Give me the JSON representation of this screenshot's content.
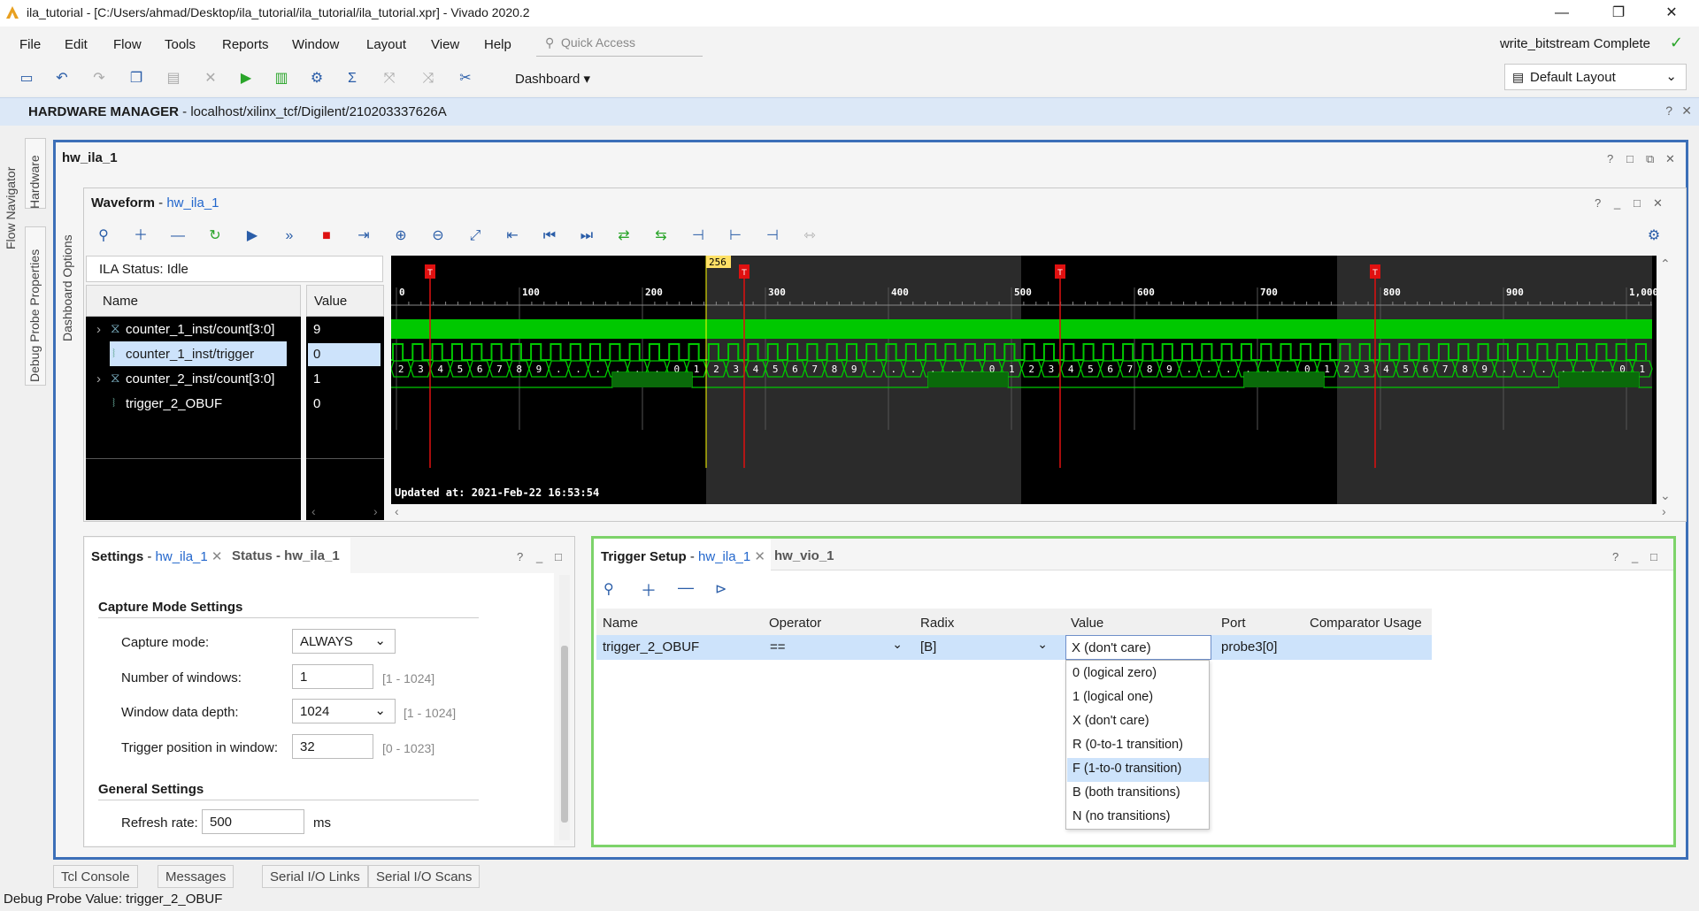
{
  "window": {
    "title": "ila_tutorial - [C:/Users/ahmad/Desktop/ila_tutorial/ila_tutorial/ila_tutorial.xpr] - Vivado 2020.2"
  },
  "menu": [
    "File",
    "Edit",
    "Flow",
    "Tools",
    "Reports",
    "Window",
    "Layout",
    "View",
    "Help"
  ],
  "quick_access": "Quick Access",
  "build_status": "write_bitstream Complete",
  "toolbar": {
    "dashboard": "Dashboard",
    "layout": "Default Layout"
  },
  "hw_manager": {
    "title": "HARDWARE MANAGER",
    "path": "- localhost/xilinx_tcf/Digilent/210203337626A"
  },
  "left_tabs": [
    "Flow Navigator",
    "Hardware",
    "Debug Probe Properties",
    "Dashboard Options"
  ],
  "main_panel": {
    "title": "hw_ila_1"
  },
  "waveform": {
    "title": "Waveform",
    "link": "hw_ila_1",
    "ila_status": "ILA Status:  Idle",
    "col_name": "Name",
    "col_value": "Value",
    "signals": [
      {
        "name": "counter_1_inst/count[3:0]",
        "value": "9",
        "type": "bus"
      },
      {
        "name": "counter_1_inst/trigger",
        "value": "0",
        "type": "bit"
      },
      {
        "name": "counter_2_inst/count[3:0]",
        "value": "1",
        "type": "bus"
      },
      {
        "name": "trigger_2_OBUF",
        "value": "0",
        "type": "bit"
      }
    ],
    "marker": "256",
    "ticks": [
      "0",
      "100",
      "200",
      "300",
      "400",
      "500",
      "600",
      "700",
      "800",
      "900",
      "1,000"
    ],
    "updated": "Updated at: 2021-Feb-22 16:53:54",
    "trigger_flags": [
      "T",
      "T",
      "T",
      "T"
    ],
    "bus2_values": [
      "2",
      "3",
      "4",
      "5",
      "6",
      "7",
      "8",
      "9",
      ".",
      ".",
      ".",
      ".",
      ".",
      ".",
      "0",
      "1",
      "2",
      "3",
      "4",
      "5",
      "6",
      "7",
      "8",
      "9",
      ".",
      ".",
      ".",
      ".",
      ".",
      ".",
      "0",
      "1",
      "2",
      "3",
      "4",
      "5",
      "6",
      "7",
      "8",
      "9",
      ".",
      ".",
      ".",
      ".",
      ".",
      ".",
      "0",
      "1",
      "2",
      "3",
      "4",
      "5",
      "6",
      "7",
      "8",
      "9",
      ".",
      ".",
      ".",
      ".",
      ".",
      ".",
      "0",
      "1"
    ]
  },
  "settings": {
    "tab_active": "Settings",
    "tab_active_link": "hw_ila_1",
    "tab_other": "Status - hw_ila_1",
    "capture_section": "Capture Mode Settings",
    "capture_mode_label": "Capture mode:",
    "capture_mode_value": "ALWAYS",
    "windows_label": "Number of windows:",
    "windows_value": "1",
    "windows_hint": "[1 - 1024]",
    "depth_label": "Window data depth:",
    "depth_value": "1024",
    "depth_hint": "[1 - 1024]",
    "trigpos_label": "Trigger position in window:",
    "trigpos_value": "32",
    "trigpos_hint": "[0 - 1023]",
    "general_section": "General Settings",
    "refresh_label": "Refresh rate:",
    "refresh_value": "500",
    "refresh_unit": "ms"
  },
  "trigger_setup": {
    "tab_active": "Trigger Setup",
    "tab_active_link": "hw_ila_1",
    "tab_other": "hw_vio_1",
    "columns": [
      "Name",
      "Operator",
      "Radix",
      "Value",
      "Port",
      "Comparator Usage"
    ],
    "row": {
      "name": "trigger_2_OBUF",
      "operator": "==",
      "radix": "[B]",
      "value": "X (don't care)",
      "port": "probe3[0]",
      "comparator": ""
    },
    "dropdown": [
      "0 (logical zero)",
      "1 (logical one)",
      "X (don't care)",
      "R (0-to-1 transition)",
      "F (1-to-0 transition)",
      "B (both transitions)",
      "N (no transitions)"
    ],
    "dropdown_selected_index": 4
  },
  "bottom_tabs": [
    "Tcl Console",
    "Messages",
    "Serial I/O Links",
    "Serial I/O Scans"
  ],
  "status_line": "Debug Probe Value: trigger_2_OBUF",
  "colors": {
    "accent": "#3c6fb8",
    "wave_green": "#00c800",
    "marker_red": "#d11",
    "selection": "#cde3fb"
  }
}
